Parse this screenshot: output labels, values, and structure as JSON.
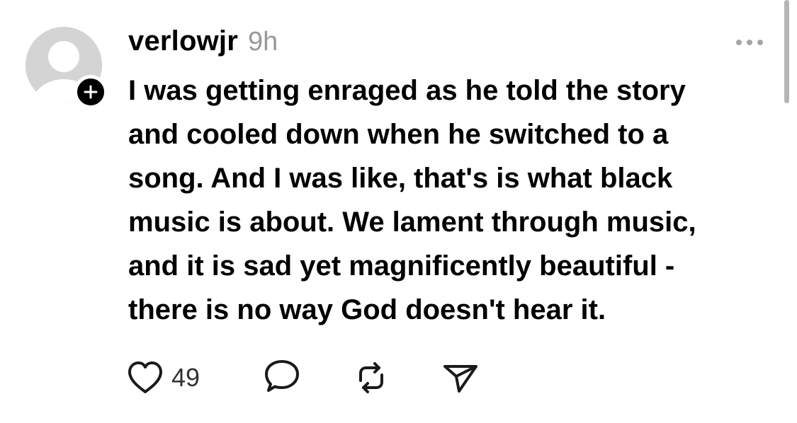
{
  "post": {
    "username": "verlowjr",
    "timestamp": "9h",
    "text_lines": [
      "I was getting enraged as he told the story",
      "and cooled down when he switched to a",
      "song. And I was like, that's is what black",
      "music is about. We lament through music,",
      "and it is sad yet magnificently beautiful -",
      "there is no way God doesn't hear it."
    ],
    "like_count": "49"
  },
  "icons": {
    "avatar": "default-avatar-icon",
    "follow": "plus-icon",
    "more": "ellipsis-icon",
    "like": "heart-icon",
    "reply": "speech-bubble-icon",
    "repost": "repost-icon",
    "share": "paper-plane-icon"
  },
  "colors": {
    "text": "#000000",
    "muted": "#999999",
    "avatar_bg": "#d4d4d4",
    "icon": "#1a1a1a"
  }
}
